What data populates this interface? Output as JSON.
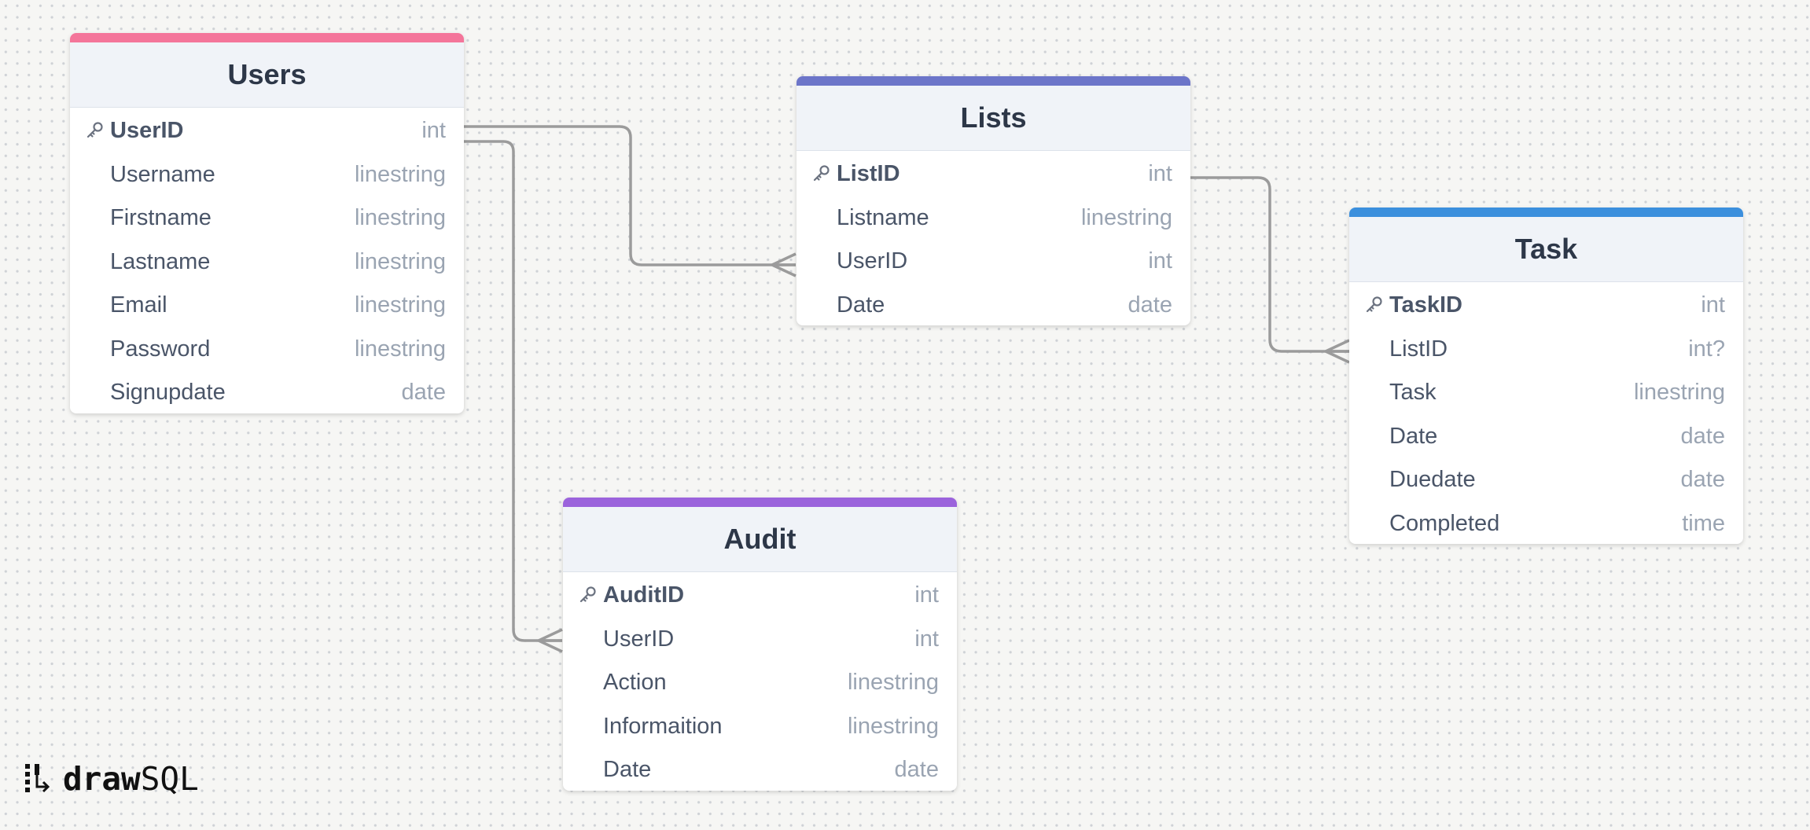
{
  "diagram": {
    "tables": [
      {
        "id": "users",
        "name": "Users",
        "accent": "#f4759a",
        "columns": [
          {
            "name": "UserID",
            "type": "int",
            "pk": true
          },
          {
            "name": "Username",
            "type": "linestring"
          },
          {
            "name": "Firstname",
            "type": "linestring"
          },
          {
            "name": "Lastname",
            "type": "linestring"
          },
          {
            "name": "Email",
            "type": "linestring"
          },
          {
            "name": "Password",
            "type": "linestring"
          },
          {
            "name": "Signupdate",
            "type": "date"
          }
        ]
      },
      {
        "id": "lists",
        "name": "Lists",
        "accent": "#6c75c9",
        "columns": [
          {
            "name": "ListID",
            "type": "int",
            "pk": true
          },
          {
            "name": "Listname",
            "type": "linestring"
          },
          {
            "name": "UserID",
            "type": "int"
          },
          {
            "name": "Date",
            "type": "date"
          }
        ]
      },
      {
        "id": "task",
        "name": "Task",
        "accent": "#3b8fdd",
        "columns": [
          {
            "name": "TaskID",
            "type": "int",
            "pk": true
          },
          {
            "name": "ListID",
            "type": "int?"
          },
          {
            "name": "Task",
            "type": "linestring"
          },
          {
            "name": "Date",
            "type": "date"
          },
          {
            "name": "Duedate",
            "type": "date"
          },
          {
            "name": "Completed",
            "type": "time"
          }
        ]
      },
      {
        "id": "audit",
        "name": "Audit",
        "accent": "#9b63dc",
        "columns": [
          {
            "name": "AuditID",
            "type": "int",
            "pk": true
          },
          {
            "name": "UserID",
            "type": "int"
          },
          {
            "name": "Action",
            "type": "linestring"
          },
          {
            "name": "Informaition",
            "type": "linestring"
          },
          {
            "name": "Date",
            "type": "date"
          }
        ]
      }
    ],
    "relationships": [
      {
        "from": "Users.UserID",
        "to": "Lists.UserID",
        "cardinality": "one-to-many"
      },
      {
        "from": "Users.UserID",
        "to": "Audit.UserID",
        "cardinality": "one-to-many"
      },
      {
        "from": "Lists.ListID",
        "to": "Task.ListID",
        "cardinality": "one-to-many"
      }
    ]
  },
  "branding": {
    "logo_bold": "draw",
    "logo_light": "SQL",
    "icon": "drawsql-logo-icon"
  }
}
